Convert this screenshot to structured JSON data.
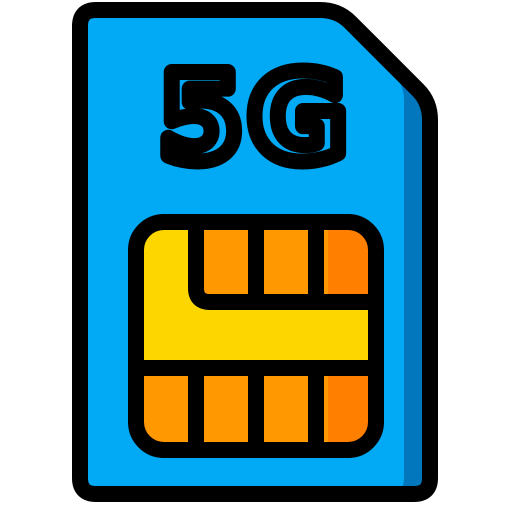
{
  "icon": {
    "name": "sim-card-5g-icon",
    "label": "5G",
    "colors": {
      "outline": "#000000",
      "card_body": "#02A9F4",
      "card_shadow": "#0377BD",
      "chip_gold": "#FDD600",
      "chip_orange": "#FF9801",
      "chip_orange_dark": "#FF7F00"
    }
  }
}
